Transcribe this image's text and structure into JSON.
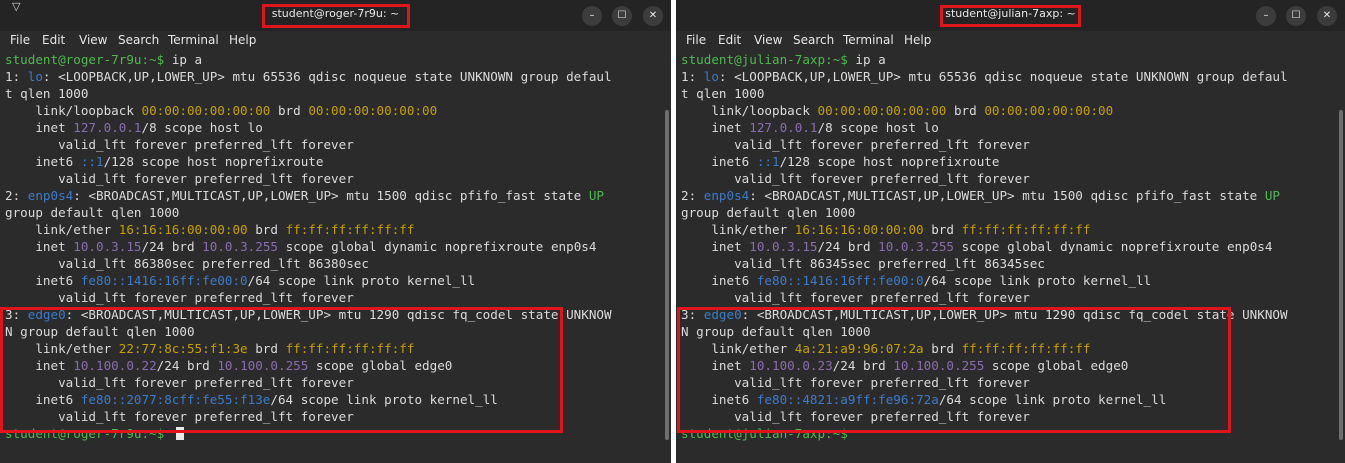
{
  "colors": {
    "green": "#4fb84f",
    "blue": "#3d7bc7",
    "yellow": "#c6a000",
    "purple": "#8a6db0",
    "highlight": "#e0141b"
  },
  "menu_labels": [
    "File",
    "Edit",
    "View",
    "Search",
    "Terminal",
    "Help"
  ],
  "window_controls": {
    "minimize": "–",
    "maximize": "☐",
    "close": "✕",
    "menu_icon": "▽"
  },
  "left": {
    "title": "student@roger-7r9u: ~",
    "prompt": "student@roger-7r9u:~$ ",
    "command": "ip a",
    "lines": [
      {
        "segs": [
          {
            "t": "1: "
          },
          {
            "t": "lo",
            "c": "b"
          },
          {
            "t": ": <LOOPBACK,UP,LOWER_UP> mtu 65536 qdisc noqueue state UNKNOWN group defaul"
          }
        ]
      },
      {
        "segs": [
          {
            "t": "t qlen 1000"
          }
        ]
      },
      {
        "segs": [
          {
            "t": "    link/loopback "
          },
          {
            "t": "00:00:00:00:00:00",
            "c": "y"
          },
          {
            "t": " brd "
          },
          {
            "t": "00:00:00:00:00:00",
            "c": "y"
          }
        ]
      },
      {
        "segs": [
          {
            "t": "    inet "
          },
          {
            "t": "127.0.0.1",
            "c": "p"
          },
          {
            "t": "/8 scope host lo"
          }
        ]
      },
      {
        "segs": [
          {
            "t": "       valid_lft forever preferred_lft forever"
          }
        ]
      },
      {
        "segs": [
          {
            "t": "    inet6 "
          },
          {
            "t": "::1",
            "c": "b"
          },
          {
            "t": "/128 scope host noprefixroute"
          }
        ]
      },
      {
        "segs": [
          {
            "t": "       valid_lft forever preferred_lft forever"
          }
        ]
      },
      {
        "segs": [
          {
            "t": "2: "
          },
          {
            "t": "enp0s4",
            "c": "b"
          },
          {
            "t": ": <BROADCAST,MULTICAST,UP,LOWER_UP> mtu 1500 qdisc pfifo_fast state "
          },
          {
            "t": "UP",
            "c": "g"
          }
        ]
      },
      {
        "segs": [
          {
            "t": "group default qlen 1000"
          }
        ]
      },
      {
        "segs": [
          {
            "t": "    link/ether "
          },
          {
            "t": "16:16:16:00:00:00",
            "c": "y"
          },
          {
            "t": " brd "
          },
          {
            "t": "ff:ff:ff:ff:ff:ff",
            "c": "y"
          }
        ]
      },
      {
        "segs": [
          {
            "t": "    inet "
          },
          {
            "t": "10.0.3.15",
            "c": "p"
          },
          {
            "t": "/24 brd "
          },
          {
            "t": "10.0.3.255",
            "c": "p"
          },
          {
            "t": " scope global dynamic noprefixroute enp0s4"
          }
        ]
      },
      {
        "segs": [
          {
            "t": "       valid_lft 86380sec preferred_lft 86380sec"
          }
        ]
      },
      {
        "segs": [
          {
            "t": "    inet6 "
          },
          {
            "t": "fe80::1416:16ff:fe00:0",
            "c": "b"
          },
          {
            "t": "/64 scope link proto kernel_ll"
          }
        ]
      },
      {
        "segs": [
          {
            "t": "       valid_lft forever preferred_lft forever"
          }
        ]
      },
      {
        "segs": [
          {
            "t": "3: "
          },
          {
            "t": "edge0",
            "c": "b"
          },
          {
            "t": ": <BROADCAST,MULTICAST,UP,LOWER_UP> mtu 1290 qdisc fq_codel state UNKNOW"
          }
        ]
      },
      {
        "segs": [
          {
            "t": "N group default qlen 1000"
          }
        ]
      },
      {
        "segs": [
          {
            "t": "    link/ether "
          },
          {
            "t": "22:77:8c:55:f1:3e",
            "c": "y"
          },
          {
            "t": " brd "
          },
          {
            "t": "ff:ff:ff:ff:ff:ff",
            "c": "y"
          }
        ]
      },
      {
        "segs": [
          {
            "t": "    inet "
          },
          {
            "t": "10.100.0.22",
            "c": "p"
          },
          {
            "t": "/24 brd "
          },
          {
            "t": "10.100.0.255",
            "c": "p"
          },
          {
            "t": " scope global edge0"
          }
        ]
      },
      {
        "segs": [
          {
            "t": "       valid_lft forever preferred_lft forever"
          }
        ]
      },
      {
        "segs": [
          {
            "t": "    inet6 "
          },
          {
            "t": "fe80::2077:8cff:fe55:f13e",
            "c": "b"
          },
          {
            "t": "/64 scope link proto kernel_ll"
          }
        ]
      },
      {
        "segs": [
          {
            "t": "       valid_lft forever preferred_lft forever"
          }
        ]
      }
    ]
  },
  "right": {
    "title": "student@julian-7axp: ~",
    "prompt": "student@julian-7axp:~$ ",
    "command": "ip a",
    "lines": [
      {
        "segs": [
          {
            "t": "1: "
          },
          {
            "t": "lo",
            "c": "b"
          },
          {
            "t": ": <LOOPBACK,UP,LOWER_UP> mtu 65536 qdisc noqueue state UNKNOWN group defaul"
          }
        ]
      },
      {
        "segs": [
          {
            "t": "t qlen 1000"
          }
        ]
      },
      {
        "segs": [
          {
            "t": "    link/loopback "
          },
          {
            "t": "00:00:00:00:00:00",
            "c": "y"
          },
          {
            "t": " brd "
          },
          {
            "t": "00:00:00:00:00:00",
            "c": "y"
          }
        ]
      },
      {
        "segs": [
          {
            "t": "    inet "
          },
          {
            "t": "127.0.0.1",
            "c": "p"
          },
          {
            "t": "/8 scope host lo"
          }
        ]
      },
      {
        "segs": [
          {
            "t": "       valid_lft forever preferred_lft forever"
          }
        ]
      },
      {
        "segs": [
          {
            "t": "    inet6 "
          },
          {
            "t": "::1",
            "c": "b"
          },
          {
            "t": "/128 scope host noprefixroute"
          }
        ]
      },
      {
        "segs": [
          {
            "t": "       valid_lft forever preferred_lft forever"
          }
        ]
      },
      {
        "segs": [
          {
            "t": "2: "
          },
          {
            "t": "enp0s4",
            "c": "b"
          },
          {
            "t": ": <BROADCAST,MULTICAST,UP,LOWER_UP> mtu 1500 qdisc pfifo_fast state "
          },
          {
            "t": "UP",
            "c": "g"
          }
        ]
      },
      {
        "segs": [
          {
            "t": "group default qlen 1000"
          }
        ]
      },
      {
        "segs": [
          {
            "t": "    link/ether "
          },
          {
            "t": "16:16:16:00:00:00",
            "c": "y"
          },
          {
            "t": " brd "
          },
          {
            "t": "ff:ff:ff:ff:ff:ff",
            "c": "y"
          }
        ]
      },
      {
        "segs": [
          {
            "t": "    inet "
          },
          {
            "t": "10.0.3.15",
            "c": "p"
          },
          {
            "t": "/24 brd "
          },
          {
            "t": "10.0.3.255",
            "c": "p"
          },
          {
            "t": " scope global dynamic noprefixroute enp0s4"
          }
        ]
      },
      {
        "segs": [
          {
            "t": "       valid_lft 86345sec preferred_lft 86345sec"
          }
        ]
      },
      {
        "segs": [
          {
            "t": "    inet6 "
          },
          {
            "t": "fe80::1416:16ff:fe00:0",
            "c": "b"
          },
          {
            "t": "/64 scope link proto kernel_ll"
          }
        ]
      },
      {
        "segs": [
          {
            "t": "       valid_lft forever preferred_lft forever"
          }
        ]
      },
      {
        "segs": [
          {
            "t": "3: "
          },
          {
            "t": "edge0",
            "c": "b"
          },
          {
            "t": ": <BROADCAST,MULTICAST,UP,LOWER_UP> mtu 1290 qdisc fq_codel state UNKNOW"
          }
        ]
      },
      {
        "segs": [
          {
            "t": "N group default qlen 1000"
          }
        ]
      },
      {
        "segs": [
          {
            "t": "    link/ether "
          },
          {
            "t": "4a:21:a9:96:07:2a",
            "c": "y"
          },
          {
            "t": " brd "
          },
          {
            "t": "ff:ff:ff:ff:ff:ff",
            "c": "y"
          }
        ]
      },
      {
        "segs": [
          {
            "t": "    inet "
          },
          {
            "t": "10.100.0.23",
            "c": "p"
          },
          {
            "t": "/24 brd "
          },
          {
            "t": "10.100.0.255",
            "c": "p"
          },
          {
            "t": " scope global edge0"
          }
        ]
      },
      {
        "segs": [
          {
            "t": "       valid_lft forever preferred_lft forever"
          }
        ]
      },
      {
        "segs": [
          {
            "t": "    inet6 "
          },
          {
            "t": "fe80::4821:a9ff:fe96:72a",
            "c": "b"
          },
          {
            "t": "/64 scope link proto kernel_ll"
          }
        ]
      },
      {
        "segs": [
          {
            "t": "       valid_lft forever preferred_lft forever"
          }
        ]
      }
    ]
  }
}
